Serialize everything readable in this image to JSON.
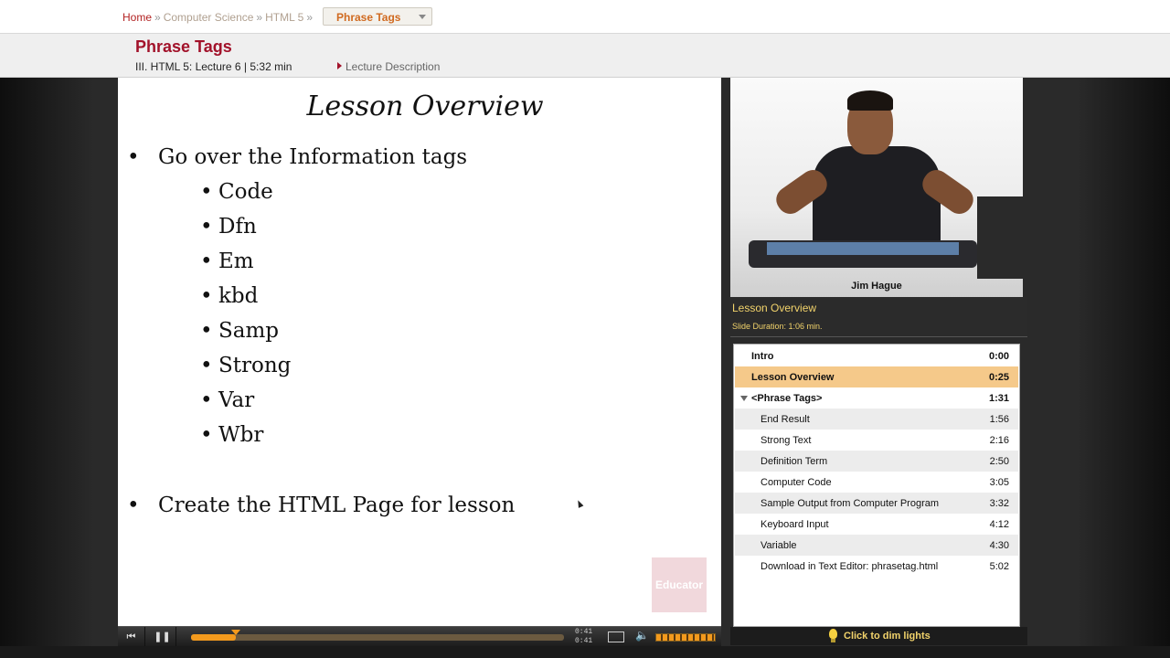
{
  "breadcrumb": {
    "items": [
      "Home",
      "Computer Science",
      "HTML 5"
    ],
    "current": "Phrase Tags"
  },
  "lecture": {
    "title": "Phrase Tags",
    "meta": "III. HTML 5: Lecture 6 | 5:32 min",
    "description_link": "Lecture Description"
  },
  "slide": {
    "title": "Lesson Overview",
    "bullet1": "Go over the Information tags",
    "subitems": [
      "Code",
      "Dfn",
      "Em",
      "kbd",
      "Samp",
      "Strong",
      "Var",
      "Wbr"
    ],
    "bullet2": "Create the HTML Page for lesson",
    "watermark": "Educator"
  },
  "player": {
    "elapsed": "0:41",
    "duration": "0:41",
    "progress_percent": 12
  },
  "video": {
    "presenter": "Jim Hague"
  },
  "slide_info": {
    "title": "Lesson Overview",
    "duration": "Slide Duration: 1:06 min."
  },
  "chapters": [
    {
      "label": "Intro",
      "time": "0:00",
      "kind": "top"
    },
    {
      "label": "Lesson Overview",
      "time": "0:25",
      "kind": "top",
      "active": true
    },
    {
      "label": "<Phrase Tags>",
      "time": "1:31",
      "kind": "parent"
    },
    {
      "label": "End Result",
      "time": "1:56",
      "kind": "child"
    },
    {
      "label": "Strong Text",
      "time": "2:16",
      "kind": "child"
    },
    {
      "label": "Definition Term",
      "time": "2:50",
      "kind": "child"
    },
    {
      "label": "Computer Code",
      "time": "3:05",
      "kind": "child"
    },
    {
      "label": "Sample Output from Computer Program",
      "time": "3:32",
      "kind": "child"
    },
    {
      "label": "Keyboard Input",
      "time": "4:12",
      "kind": "child"
    },
    {
      "label": "Variable",
      "time": "4:30",
      "kind": "child"
    },
    {
      "label": "Download in Text Editor: phrasetag.html",
      "time": "5:02",
      "kind": "child"
    }
  ],
  "dim_lights": "Click to dim lights",
  "colors": {
    "accent": "#a2122a",
    "active_row": "#f5c98a",
    "progress": "#f39a1d",
    "info_text": "#f2d36b"
  }
}
